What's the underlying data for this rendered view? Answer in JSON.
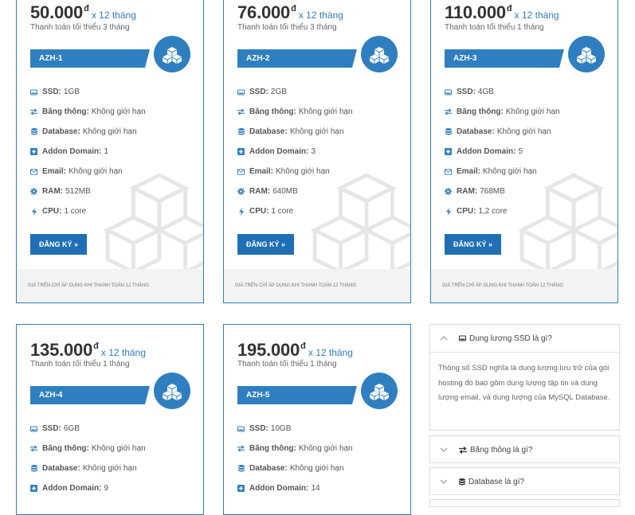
{
  "currency_symbol": "đ",
  "period": "x 12 tháng",
  "register_label": "ĐĂNG KÝ »",
  "footnote": "GIÁ TRÊN CHỈ ÁP DỤNG KHI THANH TOÁN 12 THÁNG",
  "feature_labels": {
    "ssd": "SSD:",
    "bandwidth": "Băng thông:",
    "database": "Database:",
    "addon": "Addon Domain:",
    "email": "Email:",
    "ram": "RAM:",
    "cpu": "CPU:"
  },
  "plans": [
    {
      "price": "50.000",
      "min_pay": "Thanh toán tối thiểu 3 tháng",
      "name": "AZH-1",
      "ssd": "1GB",
      "bandwidth": "Không giới hạn",
      "database": "Không giới hạn",
      "addon": "1",
      "email": "Không giới hạn",
      "ram": "512MB",
      "cpu": "1 core"
    },
    {
      "price": "76.000",
      "min_pay": "Thanh toán tối thiểu 3 tháng",
      "name": "AZH-2",
      "ssd": "2GB",
      "bandwidth": "Không giới hạn",
      "database": "Không giới hạn",
      "addon": "3",
      "email": "Không giới hạn",
      "ram": "640MB",
      "cpu": "1 core"
    },
    {
      "price": "110.000",
      "min_pay": "Thanh toán tối thiểu 1 tháng",
      "name": "AZH-3",
      "ssd": "4GB",
      "bandwidth": "Không giới hạn",
      "database": "Không giới hạn",
      "addon": "5",
      "email": "Không giới hạn",
      "ram": "768MB",
      "cpu": "1,2 core"
    },
    {
      "price": "135.000",
      "min_pay": "Thanh toán tối thiểu 1 tháng",
      "name": "AZH-4",
      "ssd": "6GB",
      "bandwidth": "Không giới hạn",
      "database": "Không giới hạn",
      "addon": "9"
    },
    {
      "price": "195.000",
      "min_pay": "Thanh toán tối thiểu 1 tháng",
      "name": "AZH-5",
      "ssd": "10GB",
      "bandwidth": "Không giới hạn",
      "database": "Không giới hạn",
      "addon": "14"
    }
  ],
  "faq": [
    {
      "title": "Dung lượng SSD là gì?",
      "icon": "drive-icon",
      "expanded": true,
      "body": "Thông số SSD nghĩa là dung lượng lưu trữ của gói hosting đó bao gồm dung lượng tập tin và dung lượng email, và dung lượng của MySQL Database."
    },
    {
      "title": "Băng thông là gì?",
      "icon": "exchange-icon",
      "expanded": false
    },
    {
      "title": "Database là gì?",
      "icon": "database-icon",
      "expanded": false
    }
  ],
  "colors": {
    "accent": "#2f7fc0",
    "button": "#1f6fb5",
    "footer_bg": "#f3f3f3"
  }
}
